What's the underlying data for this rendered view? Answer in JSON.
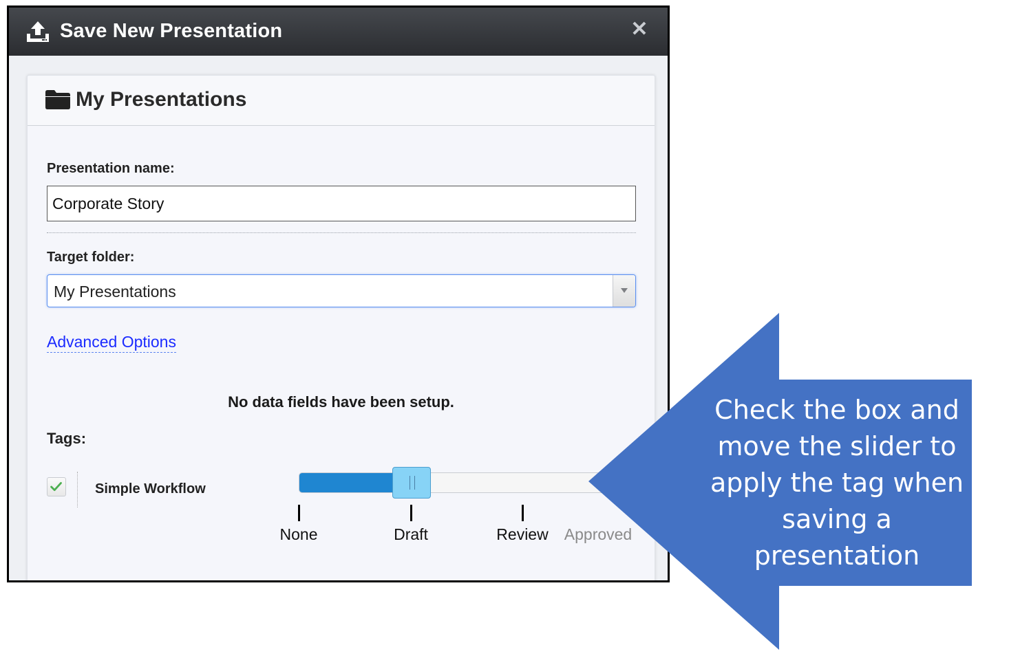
{
  "dialog": {
    "title": "Save New Presentation",
    "title_icon": "upload-icon",
    "close_icon": "close-icon"
  },
  "panel": {
    "title": "My Presentations",
    "title_icon": "folder-icon",
    "name_label": "Presentation name:",
    "name_value": "Corporate Story",
    "folder_label": "Target folder:",
    "folder_selected": "My Presentations",
    "advanced_link": "Advanced Options",
    "no_fields_message": "No data fields have been setup.",
    "tags_label": "Tags:"
  },
  "tag": {
    "name": "Simple Workflow",
    "checked": true,
    "slider": {
      "stops": [
        "None",
        "Draft",
        "Review",
        "Approved"
      ],
      "selected_index": 1,
      "dimmed_stops": [
        "Approved"
      ]
    }
  },
  "callout": {
    "lines": [
      "Check the box and",
      "move the slider to",
      "apply the tag when",
      "saving a",
      "presentation"
    ],
    "color": "#4472c4"
  },
  "colors": {
    "titlebar": "#2f3236",
    "link": "#1b2bff",
    "slider_fill": "#1f86d1",
    "slider_handle": "#87d3f6",
    "checkmark": "#4caf50"
  }
}
